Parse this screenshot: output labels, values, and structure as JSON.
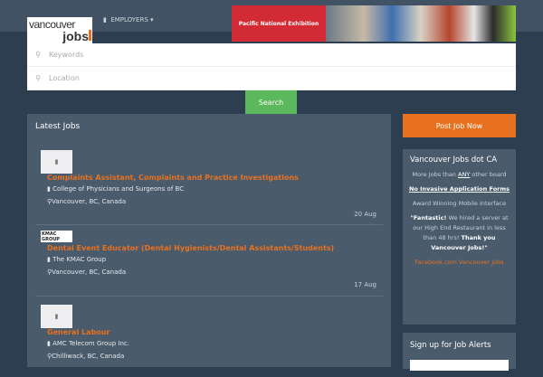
{
  "header": {
    "logo_line1": "vancouver",
    "logo_line2": "jobs",
    "employers_label": "EMPLOYERS",
    "banner_text": "Pacific National Exhibition"
  },
  "search": {
    "keywords_placeholder": "Keywords",
    "location_placeholder": "Location",
    "button": "Search"
  },
  "latest": {
    "title": "Latest Jobs",
    "jobs": [
      {
        "title": "Complaints Assistant, Complaints and Practice Investigations",
        "company": "College of Physicians and Surgeons of BC",
        "location": "Vancouver, BC, Canada",
        "date": "20 Aug"
      },
      {
        "title": "Dental Event Educator (Dental Hygienists/Dental Assistants/Students)",
        "company": "The KMAC Group",
        "location": "Vancouver, BC, Canada",
        "date": "17 Aug",
        "logo": "KMAC GROUP"
      },
      {
        "title": "General Labour",
        "company": "AMC Telecom Group Inc.",
        "location": "Chilliwack, BC, Canada"
      }
    ]
  },
  "sidebar": {
    "post_button": "Post Job Now",
    "title": "Vancouver Jobs dot CA",
    "l1a": "More Jobs than ",
    "l1b": "ANY",
    "l1c": " other board",
    "l2": " No Invasive Application Forms ",
    "l3": "Award Winning Mobile Interface",
    "q1": "\"Fantastic!",
    "q2": " We hired a server at our High End Restaurant in less than 48 hrs! ",
    "q3": "Thank you Vancouver Jobs!\"",
    "fb": "Facebook.com Vancouver Jobs",
    "alerts_title": "Sign up for Job Alerts"
  }
}
